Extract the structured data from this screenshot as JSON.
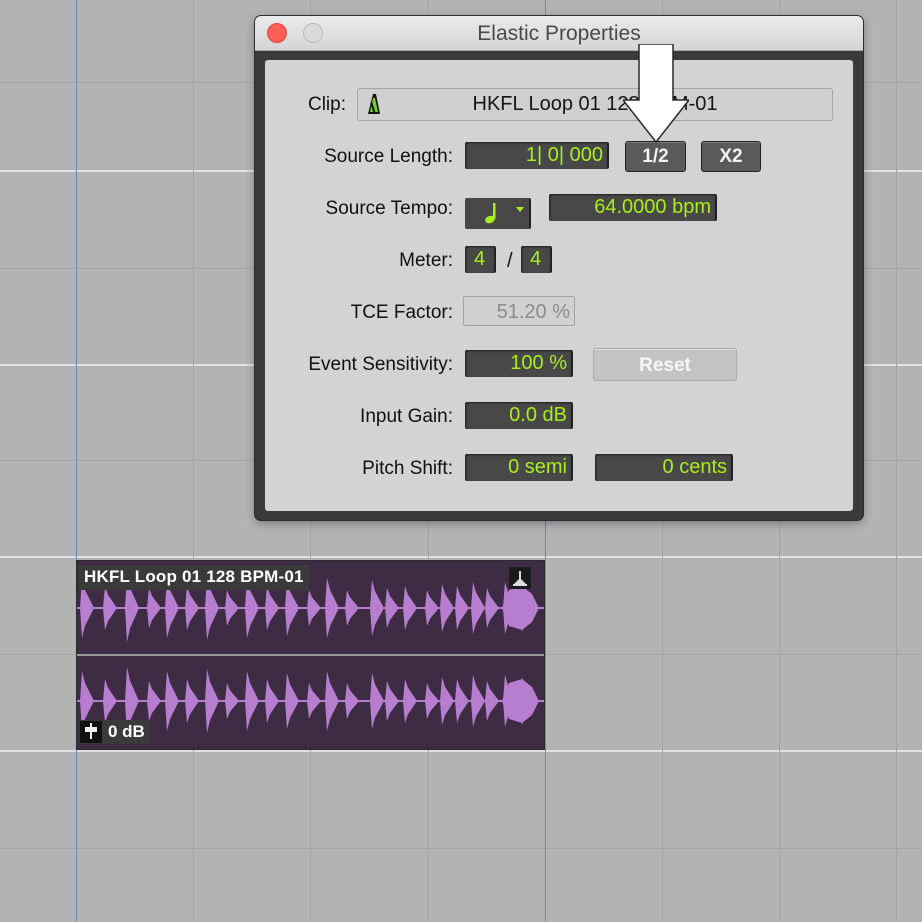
{
  "window": {
    "title": "Elastic Properties"
  },
  "fields": {
    "clip_label": "Clip:",
    "clip_value": "HKFL Loop 01 128 BPM-01",
    "source_length_label": "Source Length:",
    "source_length_value": "1| 0| 000",
    "half_button": "1/2",
    "double_button": "X2",
    "source_tempo_label": "Source Tempo:",
    "tempo_value": "64.0000 bpm",
    "meter_label": "Meter:",
    "meter_numerator": "4",
    "meter_slash": "/",
    "meter_denominator": "4",
    "tce_label": "TCE Factor:",
    "tce_value": "51.20 %",
    "sensitivity_label": "Event Sensitivity:",
    "sensitivity_value": "100 %",
    "reset_button": "Reset",
    "input_gain_label": "Input Gain:",
    "input_gain_value": "0.0 dB",
    "pitch_shift_label": "Pitch Shift:",
    "pitch_semi_value": "0 semi",
    "pitch_cents_value": "0 cents"
  },
  "clip": {
    "name": "HKFL Loop 01 128 BPM-01",
    "gain": "0 dB"
  },
  "icons": {
    "metronome": "metronome-icon",
    "quarter_note": "quarter-note-icon",
    "sync": "clip-sync-icon",
    "gain": "clip-gain-icon",
    "arrow": "pointer-arrow-annotation"
  },
  "colors": {
    "field_text": "#a8ee1c",
    "waveform": "#b77ed0",
    "clip_bg": "#3e2c45",
    "close": "#fc5f57"
  }
}
